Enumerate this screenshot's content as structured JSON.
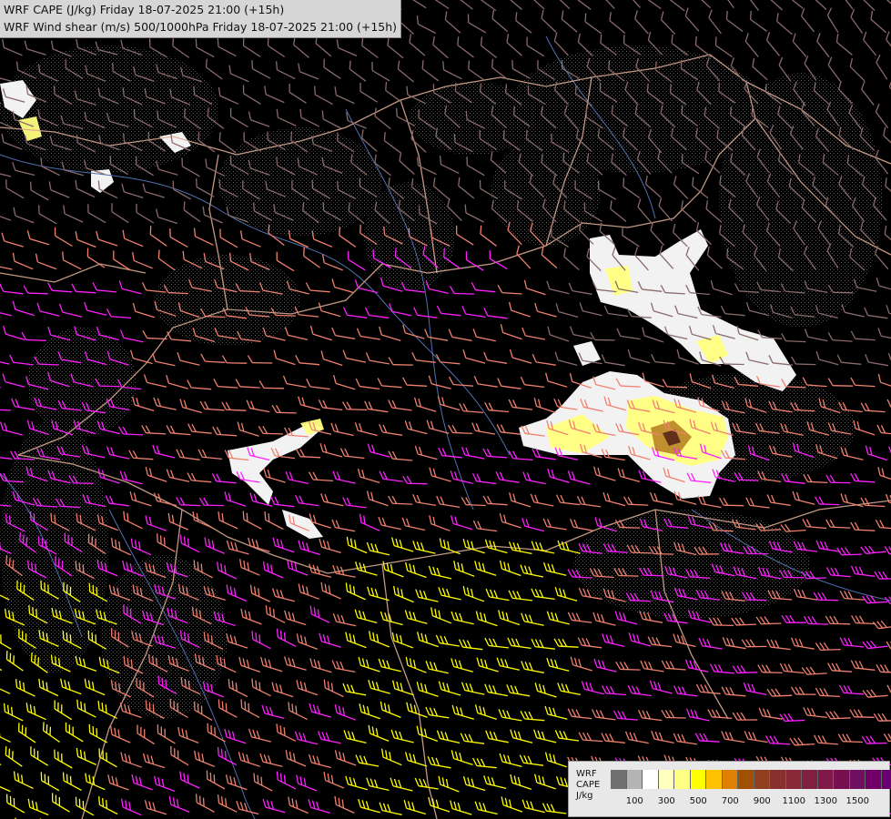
{
  "title": {
    "line1": "WRF CAPE (J/kg) Friday 18-07-2025 21:00 (+15h)",
    "line2": "WRF Wind shear (m/s) 500/1000hPa Friday 18-07-2025 21:00 (+15h)"
  },
  "legend": {
    "label_model": "WRF",
    "label_field": "CAPE",
    "label_unit": "J/kg",
    "colors": [
      "#707070",
      "#b4b4b4",
      "#ffffff",
      "#ffffc0",
      "#ffff80",
      "#ffff00",
      "#ffc000",
      "#e08000",
      "#a05000",
      "#904020",
      "#883030",
      "#882838",
      "#802040",
      "#801848",
      "#781050",
      "#701060",
      "#700068",
      "#680070"
    ],
    "ticks": [
      "100",
      "300",
      "500",
      "700",
      "900",
      "1100",
      "1300",
      "1500"
    ]
  },
  "colors": {
    "background": "#000000",
    "barb_weak": "#8a6a6a",
    "barb_moderate": "#f08070",
    "barb_strong": "#ff20ff",
    "barb_extreme": "#ffff00",
    "border": "#d8a890",
    "river": "#5070b0",
    "contour": "#909090"
  }
}
